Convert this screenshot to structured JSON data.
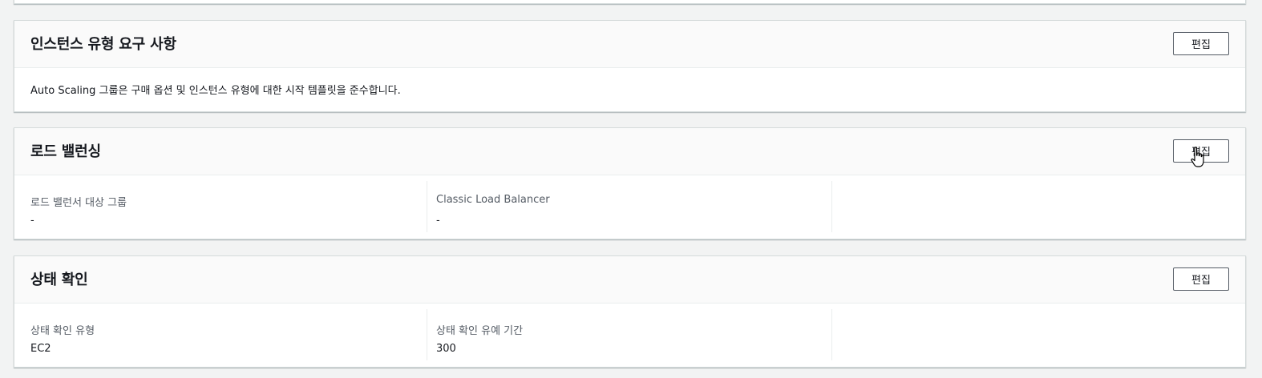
{
  "instance_requirements": {
    "title": "인스턴스 유형 요구 사항",
    "edit_label": "편집",
    "description": "Auto Scaling 그룹은 구매 옵션 및 인스턴스 유형에 대한 시작 템플릿을 준수합니다."
  },
  "load_balancing": {
    "title": "로드 밸런싱",
    "edit_label": "편집",
    "fields": [
      {
        "label": "로드 밸런서 대상 그룹",
        "value": "-"
      },
      {
        "label": "Classic Load Balancer",
        "value": "-"
      }
    ]
  },
  "health_check": {
    "title": "상태 확인",
    "edit_label": "편집",
    "fields": [
      {
        "label": "상태 확인 유형",
        "value": "EC2"
      },
      {
        "label": "상태 확인 유예 기간",
        "value": "300"
      }
    ]
  },
  "cursor": {
    "type": "hand-pointer-icon"
  }
}
